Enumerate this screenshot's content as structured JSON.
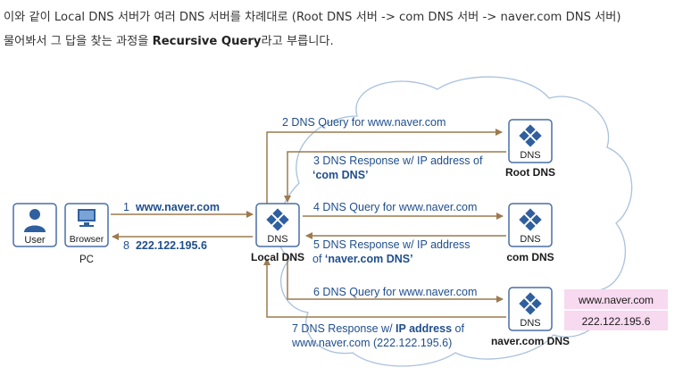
{
  "paragraph": {
    "line1": "이와 같이 Local DNS 서버가 여러 DNS 서버를 차례대로 (Root DNS 서버 -> com DNS 서버 -> naver.com DNS 서버)",
    "line2_before": "물어봐서 그 답을 찾는 과정을 ",
    "line2_bold": "Recursive Query",
    "line2_after": "라고 부릅니다."
  },
  "diagram": {
    "nodes": {
      "user_label": "User",
      "browser_label": "Browser",
      "pc_label": "PC",
      "dns_label": "DNS",
      "local_dns_label": "Local DNS",
      "root_dns_label": "Root DNS",
      "com_dns_label": "com DNS",
      "naver_dns_label": "naver.com DNS"
    },
    "steps": {
      "s1_num": "1",
      "s1_text": "www.naver.com",
      "s2": "2 DNS Query for www.naver.com",
      "s3_line1": "3  DNS Response w/ IP address of",
      "s3_line2": "‘com DNS’",
      "s4": "4  DNS Query for www.naver.com",
      "s5_line1": "5  DNS Response w/ IP address",
      "s5_line2_pre": "of ",
      "s5_line2_bold": "‘naver.com DNS’",
      "s6": "6  DNS Query for www.naver.com",
      "s7_line1_pre": "7  DNS Response w/ ",
      "s7_line1_bold": "IP address",
      "s7_line1_post": " of",
      "s7_line2": "www.naver.com (222.122.195.6)",
      "s8_num": "8",
      "s8_text": "222.122.195.6"
    },
    "record_box": {
      "domain": "www.naver.com",
      "ip": "222.122.195.6"
    },
    "colors": {
      "text_blue": "#1f4e8c",
      "arrow_brown": "#9c7b4f",
      "node_border": "#4a6fa5",
      "cloud": "#a9c1dc",
      "pink_box": "#f7d9f0"
    }
  }
}
